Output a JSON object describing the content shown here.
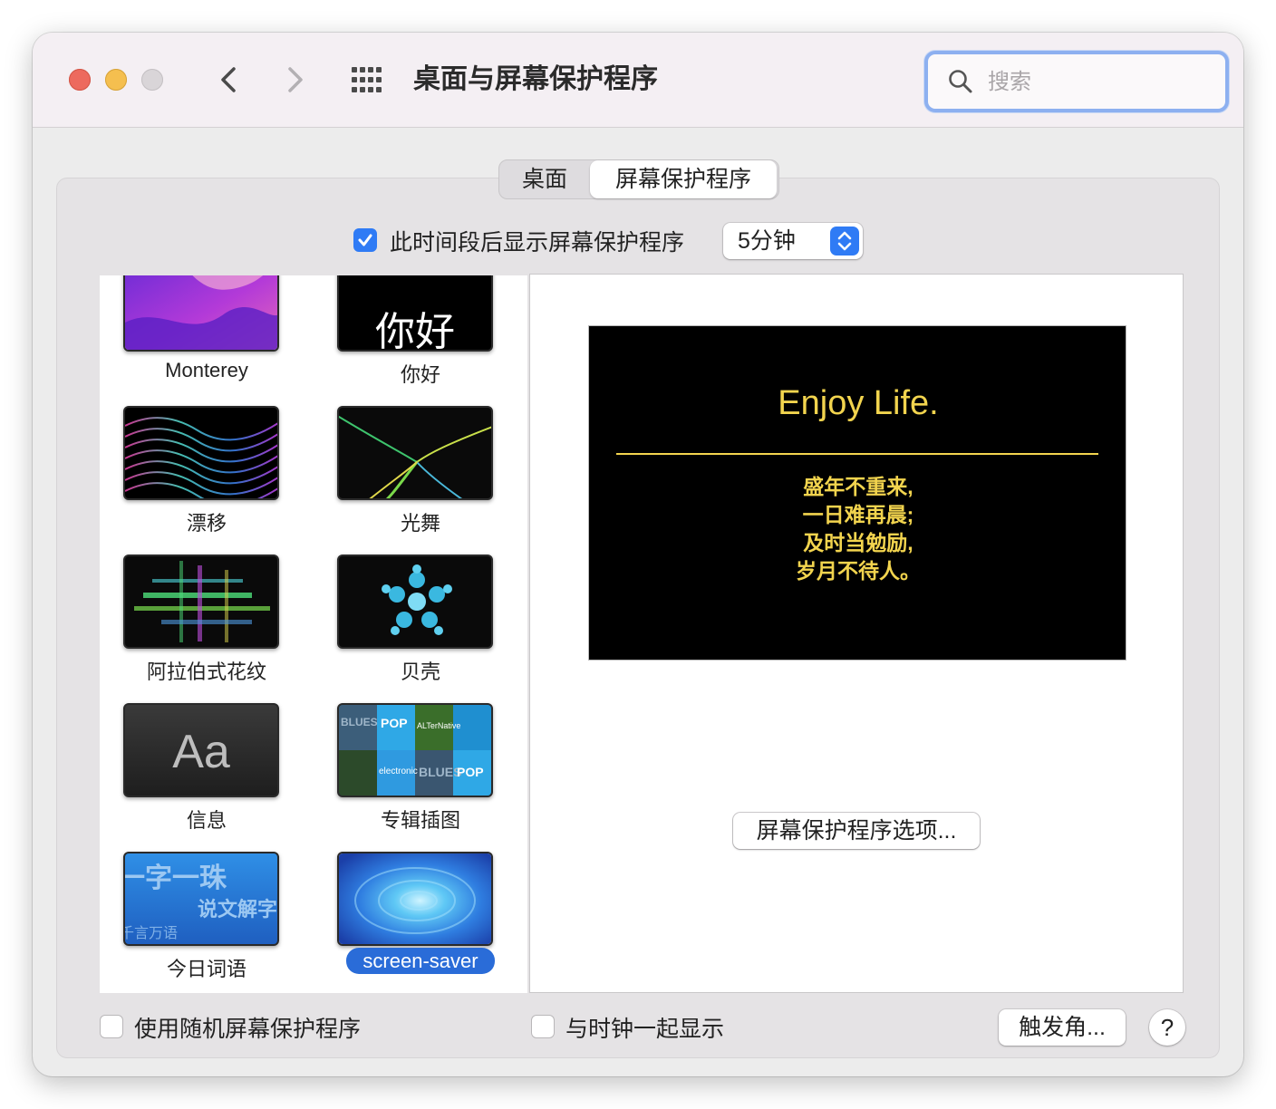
{
  "window": {
    "title": "桌面与屏幕保护程序"
  },
  "search": {
    "placeholder": "搜索"
  },
  "tabs": [
    {
      "label": "桌面",
      "selected": false
    },
    {
      "label": "屏幕保护程序",
      "selected": true
    }
  ],
  "start_after": {
    "label": "此时间段后显示屏幕保护程序",
    "checked": true,
    "value": "5分钟"
  },
  "savers": [
    {
      "name": "Monterey",
      "icon": "monterey-thumbnail",
      "selected": false
    },
    {
      "name": "你好",
      "icon": "hello-thumbnail",
      "thumb_text": "你好",
      "selected": false
    },
    {
      "name": "漂移",
      "icon": "drift-thumbnail",
      "selected": false
    },
    {
      "name": "光舞",
      "icon": "flurry-thumbnail",
      "selected": false
    },
    {
      "name": "阿拉伯式花纹",
      "icon": "arabesque-thumbnail",
      "selected": false
    },
    {
      "name": "贝壳",
      "icon": "shell-thumbnail",
      "selected": false
    },
    {
      "name": "信息",
      "icon": "message-thumbnail",
      "thumb_text": "Aa",
      "selected": false
    },
    {
      "name": "专辑插图",
      "icon": "album-artwork-thumbnail",
      "thumb_text": [
        "BLUES",
        "POP",
        "ALTerNative",
        "electronic"
      ],
      "selected": false
    },
    {
      "name": "今日词语",
      "icon": "word-of-the-day-thumbnail",
      "thumb_text": [
        "一字一珠",
        "说文解字",
        "千言万语"
      ],
      "selected": false
    },
    {
      "name": "screen-saver",
      "icon": "screen-saver-thumbnail",
      "selected": true
    }
  ],
  "preview": {
    "title": "Enjoy Life.",
    "poem": [
      "盛年不重来,",
      "一日难再晨;",
      "及时当勉励,",
      "岁月不待人。"
    ],
    "color": "#f2d44e"
  },
  "options_button": "屏幕保护程序选项...",
  "random_checkbox": {
    "label": "使用随机屏幕保护程序",
    "checked": false
  },
  "clock_checkbox": {
    "label": "与时钟一起显示",
    "checked": false
  },
  "hot_corners_button": "触发角...",
  "help_button": "?",
  "colors": {
    "accent": "#2f7bf5",
    "selection": "#2a6cd8"
  }
}
